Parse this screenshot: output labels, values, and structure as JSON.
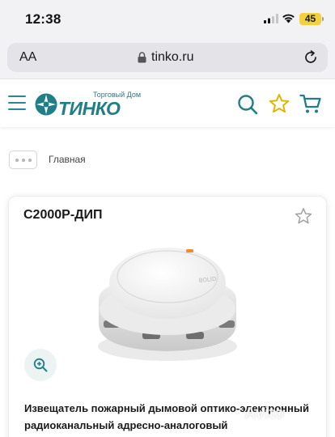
{
  "status_bar": {
    "time": "12:38",
    "battery": "45"
  },
  "browser": {
    "aa": "AA",
    "url": "tinko.ru"
  },
  "header": {
    "logo_sub": "Торговый Дом",
    "logo_main": "ТИНКО",
    "icons": [
      "menu-icon",
      "search-icon",
      "star-icon",
      "cart-icon"
    ],
    "accent_color": "#1f7e86",
    "star_color": "#e0b400"
  },
  "breadcrumb": {
    "home": "Главная"
  },
  "product": {
    "title": "С2000Р-ДИП",
    "image_label": "BOLID",
    "description": "Извещатель пожарный дымовой оптико-электронный радиоканальный адресно-аналоговый"
  },
  "watermark": "Avito"
}
